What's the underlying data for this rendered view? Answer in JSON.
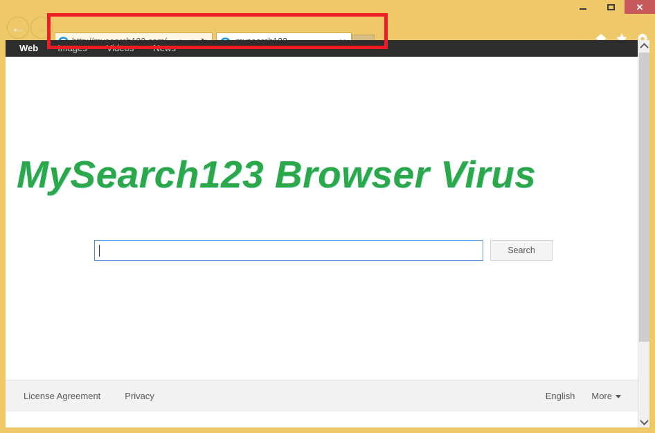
{
  "window": {
    "controls": {
      "minimize_label": "–",
      "maximize_label": "",
      "close_label": "✕"
    }
  },
  "browser": {
    "back_label": "←",
    "forward_label": "→",
    "address": {
      "url": "http://mysearch123.com/",
      "search_icon": "⌕",
      "dropdown_icon": "▾",
      "refresh_icon": "↻"
    },
    "tabs": [
      {
        "title": "mysearch123",
        "close_label": "✕"
      }
    ],
    "new_tab_label": "",
    "tools": [
      {
        "name": "home-icon"
      },
      {
        "name": "favorites-icon"
      },
      {
        "name": "settings-icon"
      }
    ]
  },
  "page": {
    "nav": [
      {
        "label": "Web",
        "active": true
      },
      {
        "label": "Images",
        "active": false
      },
      {
        "label": "Videos",
        "active": false
      },
      {
        "label": "News",
        "active": false
      }
    ],
    "headline": "MySearch123 Browser Virus",
    "search": {
      "value": "",
      "placeholder": "",
      "button_label": "Search"
    },
    "footer": {
      "license_label": "License Agreement",
      "privacy_label": "Privacy",
      "language_label": "English",
      "more_label": "More"
    }
  },
  "scrollbar": {
    "up_label": "",
    "down_label": ""
  },
  "annotation": {
    "color": "#ee1c25"
  },
  "colors": {
    "chrome": "#efc86a",
    "nav_dark": "#2d2d2d",
    "headline_green": "#2aa84a",
    "accent_orange": "#e8542a",
    "focus_blue": "#4a90e2",
    "close_red": "#c7585c"
  }
}
